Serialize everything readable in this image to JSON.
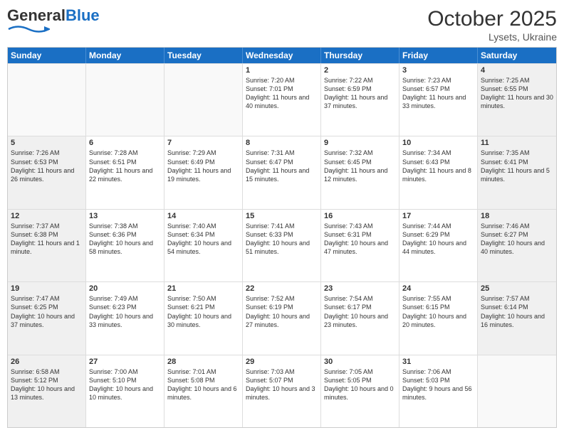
{
  "header": {
    "logo_general": "General",
    "logo_blue": "Blue",
    "month_title": "October 2025",
    "location": "Lysets, Ukraine"
  },
  "weekdays": [
    "Sunday",
    "Monday",
    "Tuesday",
    "Wednesday",
    "Thursday",
    "Friday",
    "Saturday"
  ],
  "weeks": [
    [
      {
        "day": "",
        "sunrise": "",
        "sunset": "",
        "daylight": "",
        "shaded": false,
        "empty": true
      },
      {
        "day": "",
        "sunrise": "",
        "sunset": "",
        "daylight": "",
        "shaded": false,
        "empty": true
      },
      {
        "day": "",
        "sunrise": "",
        "sunset": "",
        "daylight": "",
        "shaded": false,
        "empty": true
      },
      {
        "day": "1",
        "sunrise": "Sunrise: 7:20 AM",
        "sunset": "Sunset: 7:01 PM",
        "daylight": "Daylight: 11 hours and 40 minutes.",
        "shaded": false,
        "empty": false
      },
      {
        "day": "2",
        "sunrise": "Sunrise: 7:22 AM",
        "sunset": "Sunset: 6:59 PM",
        "daylight": "Daylight: 11 hours and 37 minutes.",
        "shaded": false,
        "empty": false
      },
      {
        "day": "3",
        "sunrise": "Sunrise: 7:23 AM",
        "sunset": "Sunset: 6:57 PM",
        "daylight": "Daylight: 11 hours and 33 minutes.",
        "shaded": false,
        "empty": false
      },
      {
        "day": "4",
        "sunrise": "Sunrise: 7:25 AM",
        "sunset": "Sunset: 6:55 PM",
        "daylight": "Daylight: 11 hours and 30 minutes.",
        "shaded": true,
        "empty": false
      }
    ],
    [
      {
        "day": "5",
        "sunrise": "Sunrise: 7:26 AM",
        "sunset": "Sunset: 6:53 PM",
        "daylight": "Daylight: 11 hours and 26 minutes.",
        "shaded": true,
        "empty": false
      },
      {
        "day": "6",
        "sunrise": "Sunrise: 7:28 AM",
        "sunset": "Sunset: 6:51 PM",
        "daylight": "Daylight: 11 hours and 22 minutes.",
        "shaded": false,
        "empty": false
      },
      {
        "day": "7",
        "sunrise": "Sunrise: 7:29 AM",
        "sunset": "Sunset: 6:49 PM",
        "daylight": "Daylight: 11 hours and 19 minutes.",
        "shaded": false,
        "empty": false
      },
      {
        "day": "8",
        "sunrise": "Sunrise: 7:31 AM",
        "sunset": "Sunset: 6:47 PM",
        "daylight": "Daylight: 11 hours and 15 minutes.",
        "shaded": false,
        "empty": false
      },
      {
        "day": "9",
        "sunrise": "Sunrise: 7:32 AM",
        "sunset": "Sunset: 6:45 PM",
        "daylight": "Daylight: 11 hours and 12 minutes.",
        "shaded": false,
        "empty": false
      },
      {
        "day": "10",
        "sunrise": "Sunrise: 7:34 AM",
        "sunset": "Sunset: 6:43 PM",
        "daylight": "Daylight: 11 hours and 8 minutes.",
        "shaded": false,
        "empty": false
      },
      {
        "day": "11",
        "sunrise": "Sunrise: 7:35 AM",
        "sunset": "Sunset: 6:41 PM",
        "daylight": "Daylight: 11 hours and 5 minutes.",
        "shaded": true,
        "empty": false
      }
    ],
    [
      {
        "day": "12",
        "sunrise": "Sunrise: 7:37 AM",
        "sunset": "Sunset: 6:38 PM",
        "daylight": "Daylight: 11 hours and 1 minute.",
        "shaded": true,
        "empty": false
      },
      {
        "day": "13",
        "sunrise": "Sunrise: 7:38 AM",
        "sunset": "Sunset: 6:36 PM",
        "daylight": "Daylight: 10 hours and 58 minutes.",
        "shaded": false,
        "empty": false
      },
      {
        "day": "14",
        "sunrise": "Sunrise: 7:40 AM",
        "sunset": "Sunset: 6:34 PM",
        "daylight": "Daylight: 10 hours and 54 minutes.",
        "shaded": false,
        "empty": false
      },
      {
        "day": "15",
        "sunrise": "Sunrise: 7:41 AM",
        "sunset": "Sunset: 6:33 PM",
        "daylight": "Daylight: 10 hours and 51 minutes.",
        "shaded": false,
        "empty": false
      },
      {
        "day": "16",
        "sunrise": "Sunrise: 7:43 AM",
        "sunset": "Sunset: 6:31 PM",
        "daylight": "Daylight: 10 hours and 47 minutes.",
        "shaded": false,
        "empty": false
      },
      {
        "day": "17",
        "sunrise": "Sunrise: 7:44 AM",
        "sunset": "Sunset: 6:29 PM",
        "daylight": "Daylight: 10 hours and 44 minutes.",
        "shaded": false,
        "empty": false
      },
      {
        "day": "18",
        "sunrise": "Sunrise: 7:46 AM",
        "sunset": "Sunset: 6:27 PM",
        "daylight": "Daylight: 10 hours and 40 minutes.",
        "shaded": true,
        "empty": false
      }
    ],
    [
      {
        "day": "19",
        "sunrise": "Sunrise: 7:47 AM",
        "sunset": "Sunset: 6:25 PM",
        "daylight": "Daylight: 10 hours and 37 minutes.",
        "shaded": true,
        "empty": false
      },
      {
        "day": "20",
        "sunrise": "Sunrise: 7:49 AM",
        "sunset": "Sunset: 6:23 PM",
        "daylight": "Daylight: 10 hours and 33 minutes.",
        "shaded": false,
        "empty": false
      },
      {
        "day": "21",
        "sunrise": "Sunrise: 7:50 AM",
        "sunset": "Sunset: 6:21 PM",
        "daylight": "Daylight: 10 hours and 30 minutes.",
        "shaded": false,
        "empty": false
      },
      {
        "day": "22",
        "sunrise": "Sunrise: 7:52 AM",
        "sunset": "Sunset: 6:19 PM",
        "daylight": "Daylight: 10 hours and 27 minutes.",
        "shaded": false,
        "empty": false
      },
      {
        "day": "23",
        "sunrise": "Sunrise: 7:54 AM",
        "sunset": "Sunset: 6:17 PM",
        "daylight": "Daylight: 10 hours and 23 minutes.",
        "shaded": false,
        "empty": false
      },
      {
        "day": "24",
        "sunrise": "Sunrise: 7:55 AM",
        "sunset": "Sunset: 6:15 PM",
        "daylight": "Daylight: 10 hours and 20 minutes.",
        "shaded": false,
        "empty": false
      },
      {
        "day": "25",
        "sunrise": "Sunrise: 7:57 AM",
        "sunset": "Sunset: 6:14 PM",
        "daylight": "Daylight: 10 hours and 16 minutes.",
        "shaded": true,
        "empty": false
      }
    ],
    [
      {
        "day": "26",
        "sunrise": "Sunrise: 6:58 AM",
        "sunset": "Sunset: 5:12 PM",
        "daylight": "Daylight: 10 hours and 13 minutes.",
        "shaded": true,
        "empty": false
      },
      {
        "day": "27",
        "sunrise": "Sunrise: 7:00 AM",
        "sunset": "Sunset: 5:10 PM",
        "daylight": "Daylight: 10 hours and 10 minutes.",
        "shaded": false,
        "empty": false
      },
      {
        "day": "28",
        "sunrise": "Sunrise: 7:01 AM",
        "sunset": "Sunset: 5:08 PM",
        "daylight": "Daylight: 10 hours and 6 minutes.",
        "shaded": false,
        "empty": false
      },
      {
        "day": "29",
        "sunrise": "Sunrise: 7:03 AM",
        "sunset": "Sunset: 5:07 PM",
        "daylight": "Daylight: 10 hours and 3 minutes.",
        "shaded": false,
        "empty": false
      },
      {
        "day": "30",
        "sunrise": "Sunrise: 7:05 AM",
        "sunset": "Sunset: 5:05 PM",
        "daylight": "Daylight: 10 hours and 0 minutes.",
        "shaded": false,
        "empty": false
      },
      {
        "day": "31",
        "sunrise": "Sunrise: 7:06 AM",
        "sunset": "Sunset: 5:03 PM",
        "daylight": "Daylight: 9 hours and 56 minutes.",
        "shaded": false,
        "empty": false
      },
      {
        "day": "",
        "sunrise": "",
        "sunset": "",
        "daylight": "",
        "shaded": true,
        "empty": true
      }
    ]
  ]
}
